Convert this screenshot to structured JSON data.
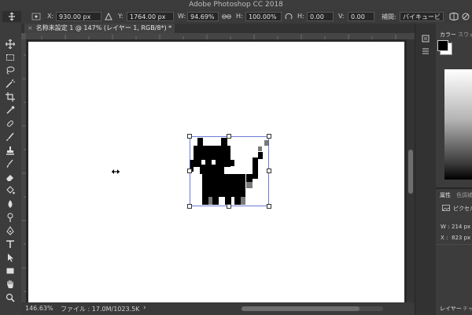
{
  "app": {
    "title": "Adobe Photoshop CC 2018"
  },
  "options_bar": {
    "x_label": "X:",
    "x_value": "930.00 px",
    "y_label": "Y:",
    "y_value": "1764.00 px",
    "w_label": "W:",
    "w_value": "94.69%",
    "h_label": "H:",
    "h_value": "100.00%",
    "hskew_label": "H:",
    "hskew_value": "0.00",
    "vskew_label": "V:",
    "vskew_value": "0.00",
    "interp_label": "補間:",
    "interp_value": "バイキュービ"
  },
  "document": {
    "tab_title": "名称未設定 1 @ 147% (レイヤー 1, RGB/8*) *",
    "close_glyph": "×"
  },
  "status": {
    "zoom": "146.63%",
    "file_info": "ファイル : 17.0M/1023.5K",
    "arrow": "›"
  },
  "panels": {
    "color_tab": "カラー",
    "swatches_tab": "スウォッチ",
    "properties_tab": "属性",
    "adjustments_tab": "色調補正",
    "pixel_layer_label": "ピクセル",
    "w_label": "W :",
    "w_value": "214 px",
    "x_label": "X :",
    "x_value": "823 px",
    "layers_tab": "レイヤー",
    "paths_tab": "チャ"
  },
  "colors": {
    "foreground": "#000000",
    "background": "#ffffff",
    "selection_border": "#4a5bd0"
  },
  "tools": [
    "move-tool",
    "marquee-tool",
    "lasso-tool",
    "magic-wand-tool",
    "crop-tool",
    "eyedropper-tool",
    "healing-brush-tool",
    "brush-tool",
    "clone-stamp-tool",
    "history-brush-tool",
    "eraser-tool",
    "paint-bucket-tool",
    "blur-tool",
    "dodge-tool",
    "pen-tool",
    "type-tool",
    "path-select-tool",
    "shape-tool",
    "hand-tool",
    "zoom-tool"
  ]
}
